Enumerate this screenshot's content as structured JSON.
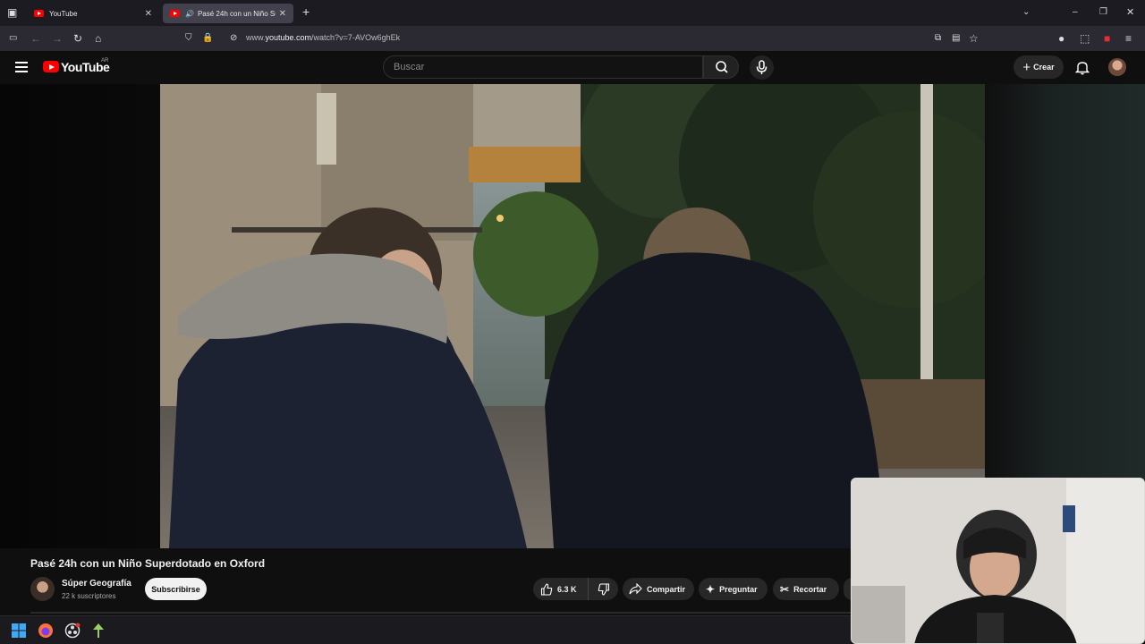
{
  "browser": {
    "tabs": [
      {
        "title": "YouTube",
        "active": false
      },
      {
        "title": "Pasé 24h con un Niño Superdotado en Oxford",
        "active": true
      }
    ],
    "url_prefix": "www.",
    "url_domain": "youtube.com",
    "url_path": "/watch?v=7-AVOw6ghEk"
  },
  "youtube": {
    "logo_text": "YouTube",
    "country_code": "AR",
    "search_placeholder": "Buscar",
    "create_label": "Crear"
  },
  "video": {
    "title": "Pasé 24h con un Niño Superdotado en Oxford",
    "channel_name": "Súper Geografía",
    "subscribers": "22 k suscriptores",
    "subscribe_label": "Subscribirse",
    "likes": "6.3 K",
    "share_label": "Compartir",
    "ask_label": "Preguntar",
    "clip_label": "Recortar"
  },
  "colors": {
    "youtube_red": "#ff0000",
    "background": "#0f0f0f",
    "pill": "#272727"
  }
}
